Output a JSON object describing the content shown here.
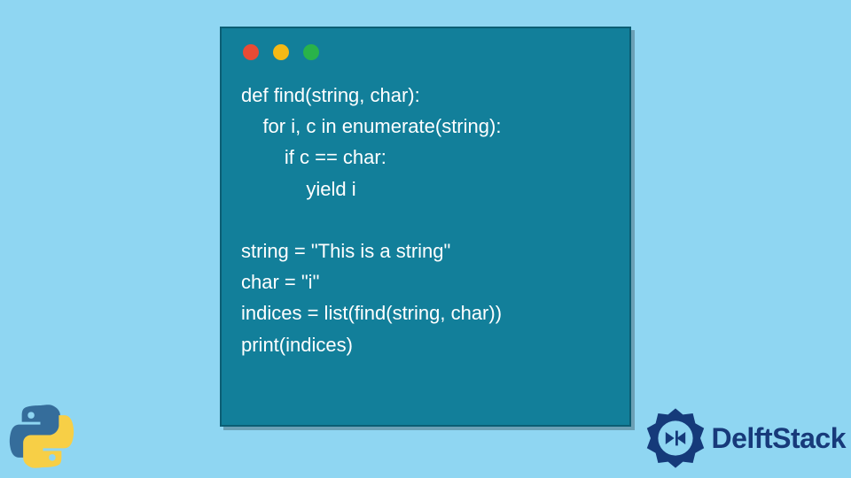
{
  "code": {
    "line1": "def find(string, char):",
    "line2": "    for i, c in enumerate(string):",
    "line3": "        if c == char:",
    "line4": "            yield i",
    "line5": "",
    "line6": "string = \"This is a string\"",
    "line7": "char = \"i\"",
    "line8": "indices = list(find(string, char))",
    "line9": "print(indices)"
  },
  "brand": {
    "name": "DelftStack"
  }
}
